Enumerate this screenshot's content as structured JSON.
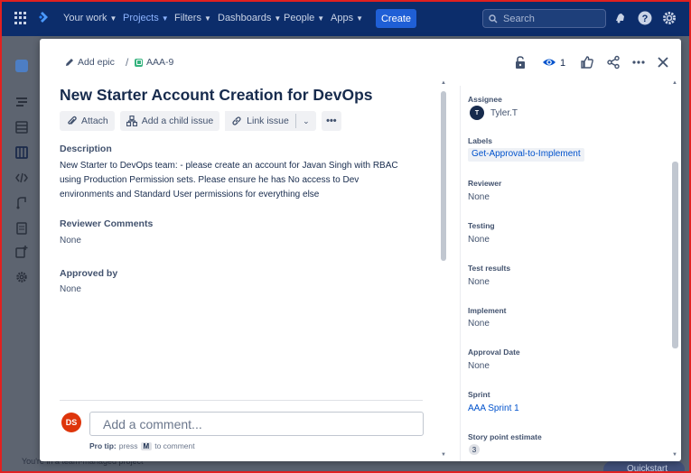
{
  "topnav": {
    "items": [
      {
        "label": "Your work",
        "active": false
      },
      {
        "label": "Projects",
        "active": true
      },
      {
        "label": "Filters",
        "active": false
      },
      {
        "label": "Dashboards",
        "active": false
      },
      {
        "label": "People",
        "active": false
      },
      {
        "label": "Apps",
        "active": false
      }
    ],
    "create_label": "Create",
    "search_placeholder": "Search",
    "icons": [
      "apps-grid-icon",
      "jira-logo-icon",
      "notifications-icon",
      "help-icon",
      "settings-icon"
    ],
    "accent": "#1f5fd6",
    "background": "#0c2d6b"
  },
  "background_page": {
    "footer_text": "You're in a team-managed project",
    "quickstart_label": "Quickstart"
  },
  "modal": {
    "breadcrumb": {
      "add_epic_label": "Add epic",
      "issue_key": "AAA-9"
    },
    "header": {
      "watch_count": "1",
      "icons": [
        "lock-icon",
        "watch-icon",
        "like-icon",
        "share-icon",
        "more-icon",
        "close-icon"
      ]
    },
    "issue": {
      "title": "New Starter Account Creation for DevOps",
      "actions": {
        "attach": "Attach",
        "add_child": "Add a child issue",
        "link_issue": "Link issue"
      },
      "description_heading": "Description",
      "description_text": "New Starter to DevOps team: - please create an account for Javan Singh with RBAC using Production Permission sets. Please ensure he has No access to Dev environments and Standard User permissions for everything else",
      "reviewer_comments_heading": "Reviewer Comments",
      "reviewer_comments_value": "None",
      "approved_by_heading": "Approved by",
      "approved_by_value": "None"
    },
    "comment": {
      "avatar_initials": "DS",
      "placeholder": "Add a comment...",
      "protip_prefix": "Pro tip:",
      "protip_press": "press",
      "protip_key": "M",
      "protip_suffix": "to comment"
    },
    "fields": {
      "assignee_label": "Assignee",
      "assignee_initial": "T",
      "assignee_name": "Tyler.T",
      "labels_label": "Labels",
      "labels_value": "Get-Approval-to-Implement",
      "reviewer_label": "Reviewer",
      "reviewer_value": "None",
      "testing_label": "Testing",
      "testing_value": "None",
      "test_results_label": "Test results",
      "test_results_value": "None",
      "implement_label": "Implement",
      "implement_value": "None",
      "approval_date_label": "Approval Date",
      "approval_date_value": "None",
      "sprint_label": "Sprint",
      "sprint_value": "AAA Sprint 1",
      "story_points_label": "Story point estimate",
      "story_points_value": "3"
    }
  }
}
